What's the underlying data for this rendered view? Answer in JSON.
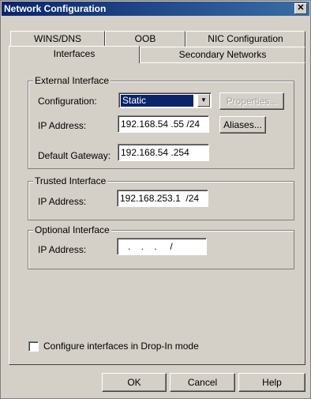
{
  "window": {
    "title": "Network Configuration",
    "close_glyph": "✕"
  },
  "tabs": {
    "row_top": [
      "WINS/DNS",
      "OOB",
      "NIC Configuration"
    ],
    "row_bottom": [
      "Interfaces",
      "Secondary Networks"
    ],
    "active": "Interfaces"
  },
  "external": {
    "legend": "External Interface",
    "config_label": "Configuration:",
    "config_value": "Static",
    "properties_label": "Properties...",
    "ip_label": "IP Address:",
    "ip_value": "192.168.54 .55 /24",
    "aliases_label": "Aliases...",
    "gateway_label": "Default Gateway:",
    "gateway_value": "192.168.54 .254"
  },
  "trusted": {
    "legend": "Trusted Interface",
    "ip_label": "IP Address:",
    "ip_value": "192.168.253.1  /24"
  },
  "optional": {
    "legend": "Optional Interface",
    "ip_label": "IP Address:",
    "ip_value": "   .    .    .     /"
  },
  "dropin": {
    "label": "Configure interfaces in Drop-In mode",
    "checked": false
  },
  "footer": {
    "ok": "OK",
    "cancel": "Cancel",
    "help": "Help"
  }
}
